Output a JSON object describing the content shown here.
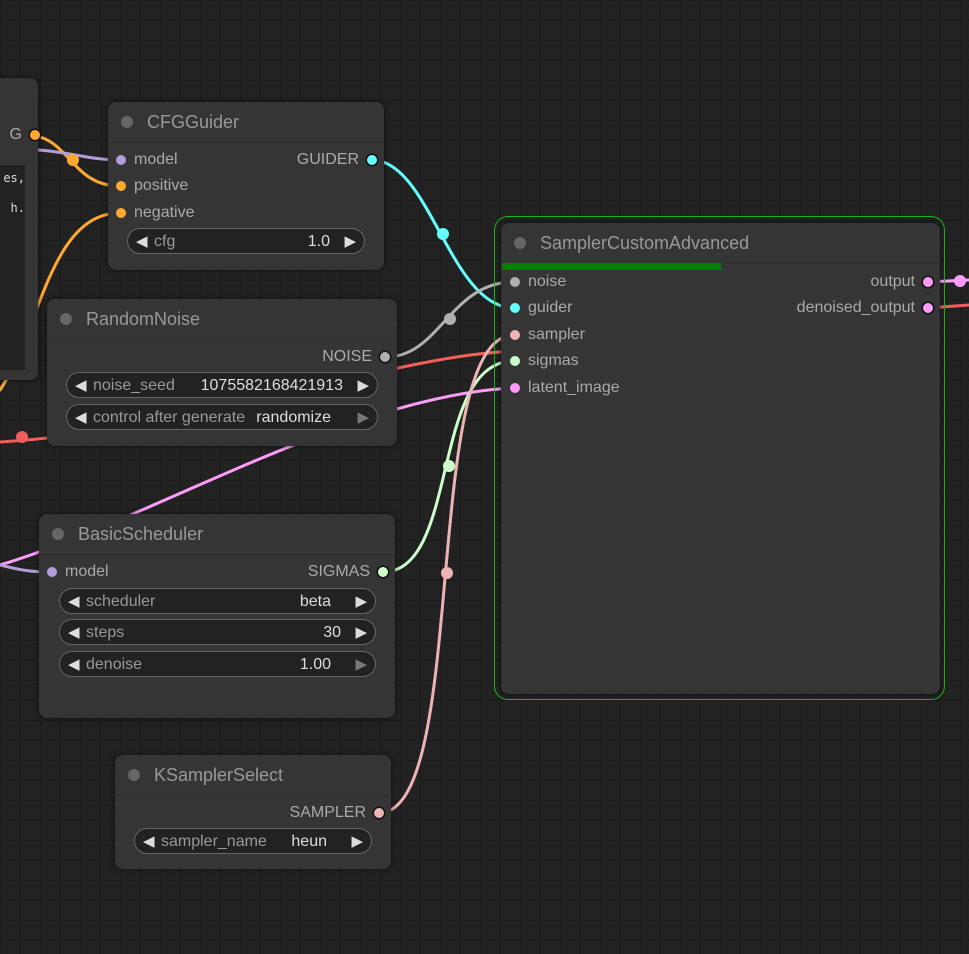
{
  "colors": {
    "clip": "#ffa931",
    "model": "#b39ddb",
    "guider": "#66ffff",
    "noise": "#b0b0b0",
    "sampler": "#ecb4b4",
    "sigmas": "#cdffcd",
    "latent": "#ff9cf9",
    "red": "#f0605a",
    "selected": "#1cb51c",
    "progress": "#008000"
  },
  "left_node": {
    "output_label": "G",
    "text_lines": [
      "es,",
      "h."
    ]
  },
  "cfg_guider": {
    "title": "CFGGuider",
    "inputs": [
      "model",
      "positive",
      "negative"
    ],
    "output": "GUIDER",
    "widgets": [
      {
        "name": "cfg",
        "value": "1.0"
      }
    ]
  },
  "random_noise": {
    "title": "RandomNoise",
    "output": "NOISE",
    "widgets": [
      {
        "name": "noise_seed",
        "value": "1075582168421913"
      },
      {
        "name": "control after generate",
        "value": "randomize"
      }
    ]
  },
  "basic_scheduler": {
    "title": "BasicScheduler",
    "inputs": [
      "model"
    ],
    "output": "SIGMAS",
    "widgets": [
      {
        "name": "scheduler",
        "value": "beta"
      },
      {
        "name": "steps",
        "value": "30"
      },
      {
        "name": "denoise",
        "value": "1.00"
      }
    ]
  },
  "ksampler_select": {
    "title": "KSamplerSelect",
    "output": "SAMPLER",
    "widgets": [
      {
        "name": "sampler_name",
        "value": "heun"
      }
    ]
  },
  "sampler_custom_advanced": {
    "title": "SamplerCustomAdvanced",
    "progress_percent": 50,
    "selected": true,
    "inputs": [
      "noise",
      "guider",
      "sampler",
      "sigmas",
      "latent_image"
    ],
    "outputs": [
      "output",
      "denoised_output"
    ]
  },
  "icons": {
    "decrement": "◀",
    "increment": "▶"
  }
}
